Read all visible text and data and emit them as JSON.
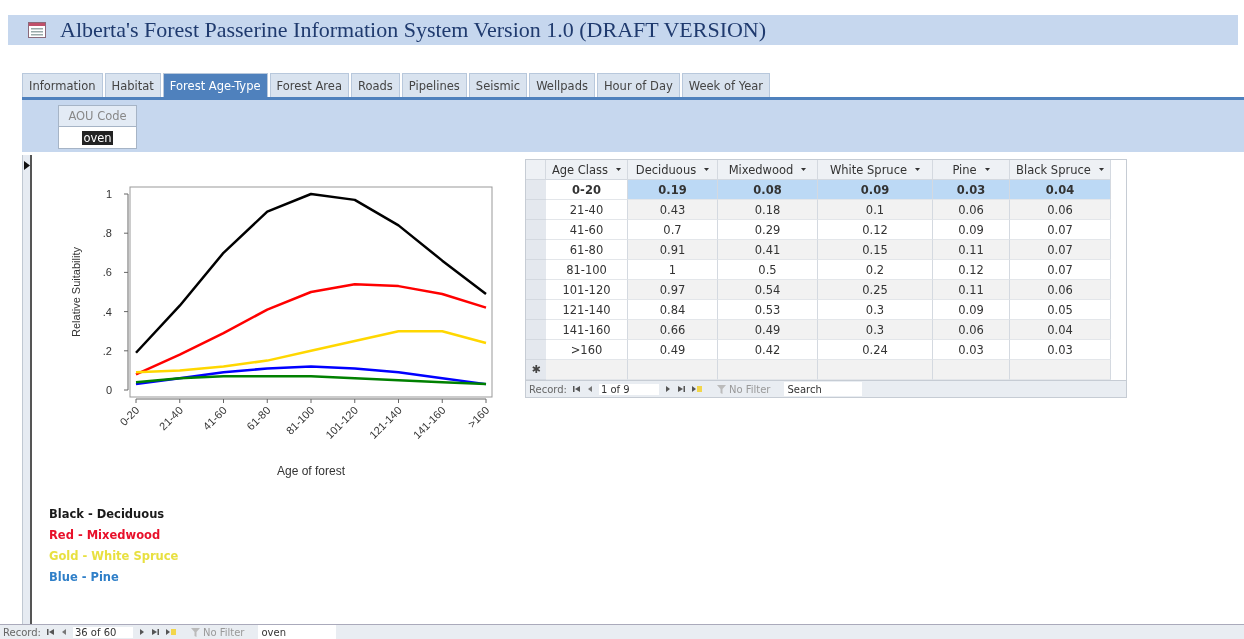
{
  "window": {
    "title": "Alberta's Forest Passerine Information System Version 1.0 (DRAFT VERSION)"
  },
  "tabs": [
    {
      "label": "Information",
      "selected": false
    },
    {
      "label": "Habitat",
      "selected": false
    },
    {
      "label": "Forest Age-Type",
      "selected": true
    },
    {
      "label": "Forest Area",
      "selected": false
    },
    {
      "label": "Roads",
      "selected": false
    },
    {
      "label": "Pipelines",
      "selected": false
    },
    {
      "label": "Seismic",
      "selected": false
    },
    {
      "label": "Wellpads",
      "selected": false
    },
    {
      "label": "Hour of Day",
      "selected": false
    },
    {
      "label": "Week of Year",
      "selected": false
    }
  ],
  "aou_code": {
    "label": "AOU Code",
    "value": "oven"
  },
  "chart": {
    "chart_data": {
      "type": "line",
      "xlabel": "Age of forest",
      "ylabel": "Relative Suitability",
      "categories": [
        "0-20",
        "21-40",
        "41-60",
        "61-80",
        "81-100",
        "101-120",
        "121-140",
        "141-160",
        ">160"
      ],
      "ylim": [
        0,
        1
      ],
      "yticks": [
        {
          "value": 0,
          "label": "0"
        },
        {
          "value": 0.2,
          "label": ".2"
        },
        {
          "value": 0.4,
          "label": ".4"
        },
        {
          "value": 0.6,
          "label": ".6"
        },
        {
          "value": 0.8,
          "label": ".8"
        },
        {
          "value": 1,
          "label": "1"
        }
      ],
      "series": [
        {
          "color": "#000000",
          "values": [
            0.19,
            0.43,
            0.7,
            0.91,
            1,
            0.97,
            0.84,
            0.66,
            0.49
          ]
        },
        {
          "color": "#ff0000",
          "values": [
            0.08,
            0.18,
            0.29,
            0.41,
            0.5,
            0.54,
            0.53,
            0.49,
            0.42
          ]
        },
        {
          "color": "#ffd700",
          "values": [
            0.09,
            0.1,
            0.12,
            0.15,
            0.2,
            0.25,
            0.3,
            0.3,
            0.24
          ]
        },
        {
          "color": "#0000ff",
          "values": [
            0.03,
            0.06,
            0.09,
            0.11,
            0.12,
            0.11,
            0.09,
            0.06,
            0.03
          ]
        },
        {
          "color": "#008000",
          "values": [
            0.04,
            0.06,
            0.07,
            0.07,
            0.07,
            0.06,
            0.05,
            0.04,
            0.03
          ]
        }
      ]
    }
  },
  "legend": [
    {
      "label": "Black - Deciduous",
      "color": "#1a1a1a"
    },
    {
      "label": "Red - Mixedwood",
      "color": "#e8102a"
    },
    {
      "label": "Gold - White Spruce",
      "color": "#e8e040"
    },
    {
      "label": "Blue - Pine",
      "color": "#2f7fc8"
    }
  ],
  "table": {
    "columns": [
      "Age Class",
      "Deciduous",
      "Mixedwood",
      "White Spruce",
      "Pine",
      "Black Spruce"
    ],
    "rows": [
      {
        "cells": [
          "0-20",
          "0.19",
          "0.08",
          "0.09",
          "0.03",
          "0.04"
        ],
        "selected": true
      },
      {
        "cells": [
          "21-40",
          "0.43",
          "0.18",
          "0.1",
          "0.06",
          "0.06"
        ],
        "selected": false
      },
      {
        "cells": [
          "41-60",
          "0.7",
          "0.29",
          "0.12",
          "0.09",
          "0.07"
        ],
        "selected": false
      },
      {
        "cells": [
          "61-80",
          "0.91",
          "0.41",
          "0.15",
          "0.11",
          "0.07"
        ],
        "selected": false
      },
      {
        "cells": [
          "81-100",
          "1",
          "0.5",
          "0.2",
          "0.12",
          "0.07"
        ],
        "selected": false
      },
      {
        "cells": [
          "101-120",
          "0.97",
          "0.54",
          "0.25",
          "0.11",
          "0.06"
        ],
        "selected": false
      },
      {
        "cells": [
          "121-140",
          "0.84",
          "0.53",
          "0.3",
          "0.09",
          "0.05"
        ],
        "selected": false
      },
      {
        "cells": [
          "141-160",
          "0.66",
          "0.49",
          "0.3",
          "0.06",
          "0.04"
        ],
        "selected": false
      },
      {
        "cells": [
          ">160",
          "0.49",
          "0.42",
          "0.24",
          "0.03",
          "0.03"
        ],
        "selected": false
      }
    ],
    "new_row_marker": "✱",
    "navigator": {
      "label": "Record:",
      "position": "1 of 9",
      "filter": "No Filter",
      "search_placeholder": "Search"
    }
  },
  "navigator": {
    "label": "Record:",
    "position": "36 of 60",
    "filter": "No Filter",
    "search_value": "oven"
  }
}
